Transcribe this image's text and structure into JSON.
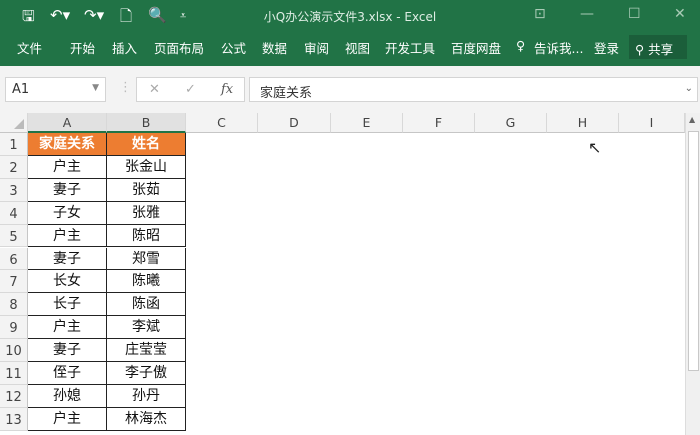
{
  "titlebar": {
    "title": "小Q办公演示文件3.xlsx - Excel",
    "icons": [
      "save-icon",
      "undo-icon",
      "redo-icon",
      "new-icon",
      "print-preview-icon",
      "customize-qat-icon"
    ]
  },
  "ribbon": {
    "tabs": [
      "文件",
      "开始",
      "插入",
      "页面布局",
      "公式",
      "数据",
      "审阅",
      "视图",
      "开发工具",
      "百度网盘"
    ],
    "tell_me": "告诉我...",
    "login": "登录",
    "share": "共享"
  },
  "formula_bar": {
    "name_box": "A1",
    "formula": "家庭关系",
    "fx": "fx"
  },
  "columns": [
    "A",
    "B",
    "C",
    "D",
    "E",
    "F",
    "G",
    "H",
    "I"
  ],
  "rows": [
    [
      "家庭关系",
      "姓名"
    ],
    [
      "户主",
      "张金山"
    ],
    [
      "妻子",
      "张茹"
    ],
    [
      "子女",
      "张雅"
    ],
    [
      "户主",
      "陈昭"
    ],
    [
      "妻子",
      "郑雪"
    ],
    [
      "长女",
      "陈曦"
    ],
    [
      "长子",
      "陈函"
    ],
    [
      "户主",
      "李斌"
    ],
    [
      "妻子",
      "庄莹莹"
    ],
    [
      "侄子",
      "李子傲"
    ],
    [
      "孙媳",
      "孙丹"
    ],
    [
      "户主",
      "林海杰"
    ]
  ],
  "colors": {
    "accent": "#217346",
    "header_fill": "#ed7d31"
  }
}
